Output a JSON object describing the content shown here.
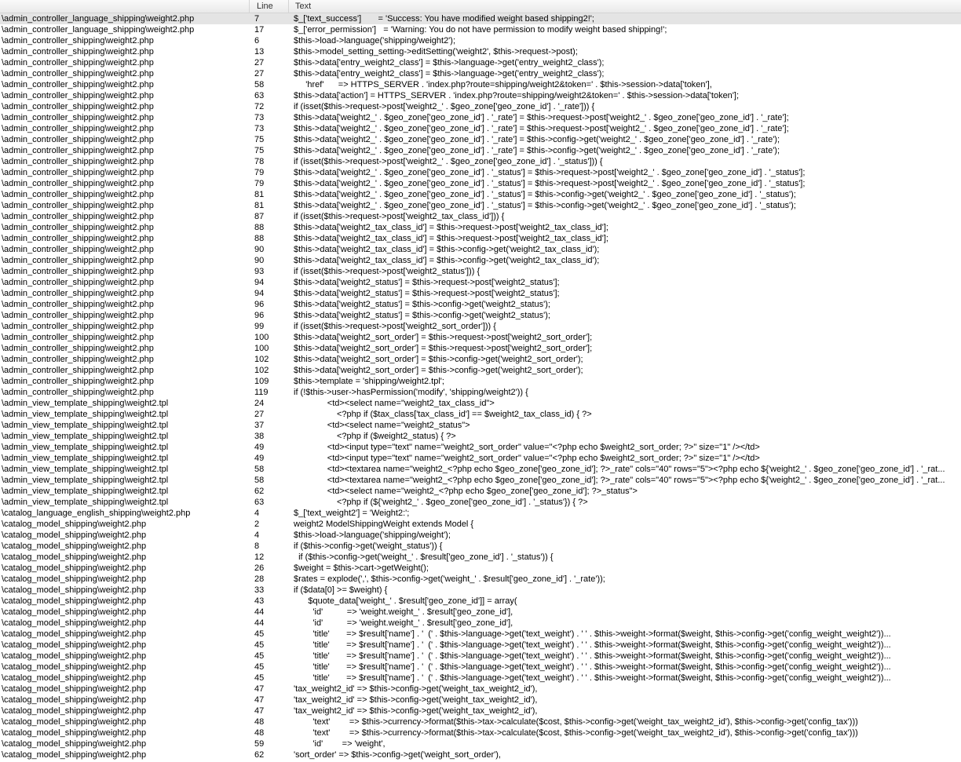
{
  "columns": {
    "file": "",
    "line": "Line",
    "text": "Text"
  },
  "rows": [
    {
      "file": "\\admin_controller_language_shipping\\weight2.php",
      "line": "7",
      "text": "$_['text_success']       = 'Success: You have modified weight based shipping2!';"
    },
    {
      "file": "\\admin_controller_language_shipping\\weight2.php",
      "line": "17",
      "text": "$_['error_permission']   = 'Warning: You do not have permission to modify weight based shipping!';"
    },
    {
      "file": "\\admin_controller_shipping\\weight2.php",
      "line": "6",
      "text": "$this->load->language('shipping/weight2');"
    },
    {
      "file": "\\admin_controller_shipping\\weight2.php",
      "line": "13",
      "text": "$this->model_setting_setting->editSetting('weight2', $this->request->post);"
    },
    {
      "file": "\\admin_controller_shipping\\weight2.php",
      "line": "27",
      "text": "$this->data['entry_weight2_class'] = $this->language->get('entry_weight2_class');"
    },
    {
      "file": "\\admin_controller_shipping\\weight2.php",
      "line": "27",
      "text": "$this->data['entry_weight2_class'] = $this->language->get('entry_weight2_class');"
    },
    {
      "file": "\\admin_controller_shipping\\weight2.php",
      "line": "58",
      "text": "     'href'      => HTTPS_SERVER . 'index.php?route=shipping/weight2&token=' . $this->session->data['token'],"
    },
    {
      "file": "\\admin_controller_shipping\\weight2.php",
      "line": "63",
      "text": "$this->data['action'] = HTTPS_SERVER . 'index.php?route=shipping/weight2&token=' . $this->session->data['token'];"
    },
    {
      "file": "\\admin_controller_shipping\\weight2.php",
      "line": "72",
      "text": "if (isset($this->request->post['weight2_' . $geo_zone['geo_zone_id'] . '_rate'])) {"
    },
    {
      "file": "\\admin_controller_shipping\\weight2.php",
      "line": "73",
      "text": "$this->data['weight2_' . $geo_zone['geo_zone_id'] . '_rate'] = $this->request->post['weight2_' . $geo_zone['geo_zone_id'] . '_rate'];"
    },
    {
      "file": "\\admin_controller_shipping\\weight2.php",
      "line": "73",
      "text": "$this->data['weight2_' . $geo_zone['geo_zone_id'] . '_rate'] = $this->request->post['weight2_' . $geo_zone['geo_zone_id'] . '_rate'];"
    },
    {
      "file": "\\admin_controller_shipping\\weight2.php",
      "line": "75",
      "text": "$this->data['weight2_' . $geo_zone['geo_zone_id'] . '_rate'] = $this->config->get('weight2_' . $geo_zone['geo_zone_id'] . '_rate');"
    },
    {
      "file": "\\admin_controller_shipping\\weight2.php",
      "line": "75",
      "text": "$this->data['weight2_' . $geo_zone['geo_zone_id'] . '_rate'] = $this->config->get('weight2_' . $geo_zone['geo_zone_id'] . '_rate');"
    },
    {
      "file": "\\admin_controller_shipping\\weight2.php",
      "line": "78",
      "text": "if (isset($this->request->post['weight2_' . $geo_zone['geo_zone_id'] . '_status'])) {"
    },
    {
      "file": "\\admin_controller_shipping\\weight2.php",
      "line": "79",
      "text": "$this->data['weight2_' . $geo_zone['geo_zone_id'] . '_status'] = $this->request->post['weight2_' . $geo_zone['geo_zone_id'] . '_status'];"
    },
    {
      "file": "\\admin_controller_shipping\\weight2.php",
      "line": "79",
      "text": "$this->data['weight2_' . $geo_zone['geo_zone_id'] . '_status'] = $this->request->post['weight2_' . $geo_zone['geo_zone_id'] . '_status'];"
    },
    {
      "file": "\\admin_controller_shipping\\weight2.php",
      "line": "81",
      "text": "$this->data['weight2_' . $geo_zone['geo_zone_id'] . '_status'] = $this->config->get('weight2_' . $geo_zone['geo_zone_id'] . '_status');"
    },
    {
      "file": "\\admin_controller_shipping\\weight2.php",
      "line": "81",
      "text": "$this->data['weight2_' . $geo_zone['geo_zone_id'] . '_status'] = $this->config->get('weight2_' . $geo_zone['geo_zone_id'] . '_status');"
    },
    {
      "file": "\\admin_controller_shipping\\weight2.php",
      "line": "87",
      "text": "if (isset($this->request->post['weight2_tax_class_id'])) {"
    },
    {
      "file": "\\admin_controller_shipping\\weight2.php",
      "line": "88",
      "text": "$this->data['weight2_tax_class_id'] = $this->request->post['weight2_tax_class_id'];"
    },
    {
      "file": "\\admin_controller_shipping\\weight2.php",
      "line": "88",
      "text": "$this->data['weight2_tax_class_id'] = $this->request->post['weight2_tax_class_id'];"
    },
    {
      "file": "\\admin_controller_shipping\\weight2.php",
      "line": "90",
      "text": "$this->data['weight2_tax_class_id'] = $this->config->get('weight2_tax_class_id');"
    },
    {
      "file": "\\admin_controller_shipping\\weight2.php",
      "line": "90",
      "text": "$this->data['weight2_tax_class_id'] = $this->config->get('weight2_tax_class_id');"
    },
    {
      "file": "\\admin_controller_shipping\\weight2.php",
      "line": "93",
      "text": "if (isset($this->request->post['weight2_status'])) {"
    },
    {
      "file": "\\admin_controller_shipping\\weight2.php",
      "line": "94",
      "text": "$this->data['weight2_status'] = $this->request->post['weight2_status'];"
    },
    {
      "file": "\\admin_controller_shipping\\weight2.php",
      "line": "94",
      "text": "$this->data['weight2_status'] = $this->request->post['weight2_status'];"
    },
    {
      "file": "\\admin_controller_shipping\\weight2.php",
      "line": "96",
      "text": "$this->data['weight2_status'] = $this->config->get('weight2_status');"
    },
    {
      "file": "\\admin_controller_shipping\\weight2.php",
      "line": "96",
      "text": "$this->data['weight2_status'] = $this->config->get('weight2_status');"
    },
    {
      "file": "\\admin_controller_shipping\\weight2.php",
      "line": "99",
      "text": "if (isset($this->request->post['weight2_sort_order'])) {"
    },
    {
      "file": "\\admin_controller_shipping\\weight2.php",
      "line": "100",
      "text": "$this->data['weight2_sort_order'] = $this->request->post['weight2_sort_order'];"
    },
    {
      "file": "\\admin_controller_shipping\\weight2.php",
      "line": "100",
      "text": "$this->data['weight2_sort_order'] = $this->request->post['weight2_sort_order'];"
    },
    {
      "file": "\\admin_controller_shipping\\weight2.php",
      "line": "102",
      "text": "$this->data['weight2_sort_order'] = $this->config->get('weight2_sort_order');"
    },
    {
      "file": "\\admin_controller_shipping\\weight2.php",
      "line": "102",
      "text": "$this->data['weight2_sort_order'] = $this->config->get('weight2_sort_order');"
    },
    {
      "file": "\\admin_controller_shipping\\weight2.php",
      "line": "109",
      "text": "$this->template = 'shipping/weight2.tpl';"
    },
    {
      "file": "\\admin_controller_shipping\\weight2.php",
      "line": "119",
      "text": "if (!$this->user->hasPermission('modify', 'shipping/weight2')) {"
    },
    {
      "file": "\\admin_view_template_shipping\\weight2.tpl",
      "line": "24",
      "text": "              <td><select name=\"weight2_tax_class_id\">"
    },
    {
      "file": "\\admin_view_template_shipping\\weight2.tpl",
      "line": "27",
      "text": "                  <?php if ($tax_class['tax_class_id'] == $weight2_tax_class_id) { ?>"
    },
    {
      "file": "\\admin_view_template_shipping\\weight2.tpl",
      "line": "37",
      "text": "              <td><select name=\"weight2_status\">"
    },
    {
      "file": "\\admin_view_template_shipping\\weight2.tpl",
      "line": "38",
      "text": "                  <?php if ($weight2_status) { ?>"
    },
    {
      "file": "\\admin_view_template_shipping\\weight2.tpl",
      "line": "49",
      "text": "              <td><input type=\"text\" name=\"weight2_sort_order\" value=\"<?php echo $weight2_sort_order; ?>\" size=\"1\" /></td>"
    },
    {
      "file": "\\admin_view_template_shipping\\weight2.tpl",
      "line": "49",
      "text": "              <td><input type=\"text\" name=\"weight2_sort_order\" value=\"<?php echo $weight2_sort_order; ?>\" size=\"1\" /></td>"
    },
    {
      "file": "\\admin_view_template_shipping\\weight2.tpl",
      "line": "58",
      "text": "              <td><textarea name=\"weight2_<?php echo $geo_zone['geo_zone_id']; ?>_rate\" cols=\"40\" rows=\"5\"><?php echo ${'weight2_' . $geo_zone['geo_zone_id'] . '_rat..."
    },
    {
      "file": "\\admin_view_template_shipping\\weight2.tpl",
      "line": "58",
      "text": "              <td><textarea name=\"weight2_<?php echo $geo_zone['geo_zone_id']; ?>_rate\" cols=\"40\" rows=\"5\"><?php echo ${'weight2_' . $geo_zone['geo_zone_id'] . '_rat..."
    },
    {
      "file": "\\admin_view_template_shipping\\weight2.tpl",
      "line": "62",
      "text": "              <td><select name=\"weight2_<?php echo $geo_zone['geo_zone_id']; ?>_status\">"
    },
    {
      "file": "\\admin_view_template_shipping\\weight2.tpl",
      "line": "63",
      "text": "                  <?php if (${'weight2_' . $geo_zone['geo_zone_id'] . '_status'}) { ?>"
    },
    {
      "file": "\\catalog_language_english_shipping\\weight2.php",
      "line": "4",
      "text": "$_['text_weight2'] = 'Weight2:';"
    },
    {
      "file": "\\catalog_model_shipping\\weight2.php",
      "line": "2",
      "text": "weight2 ModelShippingWeight extends Model {"
    },
    {
      "file": "\\catalog_model_shipping\\weight2.php",
      "line": "4",
      "text": "$this->load->language('shipping/weight');"
    },
    {
      "file": "\\catalog_model_shipping\\weight2.php",
      "line": "8",
      "text": "if ($this->config->get('weight_status')) {"
    },
    {
      "file": "\\catalog_model_shipping\\weight2.php",
      "line": "12",
      "text": "  if ($this->config->get('weight_' . $result['geo_zone_id'] . '_status')) {"
    },
    {
      "file": "\\catalog_model_shipping\\weight2.php",
      "line": "26",
      "text": "$weight = $this->cart->getWeight();"
    },
    {
      "file": "\\catalog_model_shipping\\weight2.php",
      "line": "28",
      "text": "$rates = explode(',', $this->config->get('weight_' . $result['geo_zone_id'] . '_rate'));"
    },
    {
      "file": "\\catalog_model_shipping\\weight2.php",
      "line": "33",
      "text": "if ($data[0] >= $weight) {"
    },
    {
      "file": "\\catalog_model_shipping\\weight2.php",
      "line": "43",
      "text": "      $quote_data['weight_' . $result['geo_zone_id']] = array("
    },
    {
      "file": "\\catalog_model_shipping\\weight2.php",
      "line": "44",
      "text": "        'id'          => 'weight.weight_' . $result['geo_zone_id'],"
    },
    {
      "file": "\\catalog_model_shipping\\weight2.php",
      "line": "44",
      "text": "        'id'          => 'weight.weight_' . $result['geo_zone_id'],"
    },
    {
      "file": "\\catalog_model_shipping\\weight2.php",
      "line": "45",
      "text": "        'title'       => $result['name'] . '  (' . $this->language->get('text_weight') . ' ' . $this->weight->format($weight, $this->config->get('config_weight_weight2'))..."
    },
    {
      "file": "\\catalog_model_shipping\\weight2.php",
      "line": "45",
      "text": "        'title'       => $result['name'] . '  (' . $this->language->get('text_weight') . ' ' . $this->weight->format($weight, $this->config->get('config_weight_weight2'))..."
    },
    {
      "file": "\\catalog_model_shipping\\weight2.php",
      "line": "45",
      "text": "        'title'       => $result['name'] . '  (' . $this->language->get('text_weight') . ' ' . $this->weight->format($weight, $this->config->get('config_weight_weight2'))..."
    },
    {
      "file": "\\catalog_model_shipping\\weight2.php",
      "line": "45",
      "text": "        'title'       => $result['name'] . '  (' . $this->language->get('text_weight') . ' ' . $this->weight->format($weight, $this->config->get('config_weight_weight2'))..."
    },
    {
      "file": "\\catalog_model_shipping\\weight2.php",
      "line": "45",
      "text": "        'title'       => $result['name'] . '  (' . $this->language->get('text_weight') . ' ' . $this->weight->format($weight, $this->config->get('config_weight_weight2'))..."
    },
    {
      "file": "\\catalog_model_shipping\\weight2.php",
      "line": "47",
      "text": "'tax_weight2_id' => $this->config->get('weight_tax_weight2_id'),"
    },
    {
      "file": "\\catalog_model_shipping\\weight2.php",
      "line": "47",
      "text": "'tax_weight2_id' => $this->config->get('weight_tax_weight2_id'),"
    },
    {
      "file": "\\catalog_model_shipping\\weight2.php",
      "line": "47",
      "text": "'tax_weight2_id' => $this->config->get('weight_tax_weight2_id'),"
    },
    {
      "file": "\\catalog_model_shipping\\weight2.php",
      "line": "48",
      "text": "        'text'        => $this->currency->format($this->tax->calculate($cost, $this->config->get('weight_tax_weight2_id'), $this->config->get('config_tax')))"
    },
    {
      "file": "\\catalog_model_shipping\\weight2.php",
      "line": "48",
      "text": "        'text'        => $this->currency->format($this->tax->calculate($cost, $this->config->get('weight_tax_weight2_id'), $this->config->get('config_tax')))"
    },
    {
      "file": "\\catalog_model_shipping\\weight2.php",
      "line": "59",
      "text": "        'id'        => 'weight',"
    },
    {
      "file": "\\catalog_model_shipping\\weight2.php",
      "line": "62",
      "text": "'sort_order' => $this->config->get('weight_sort_order'),"
    }
  ]
}
